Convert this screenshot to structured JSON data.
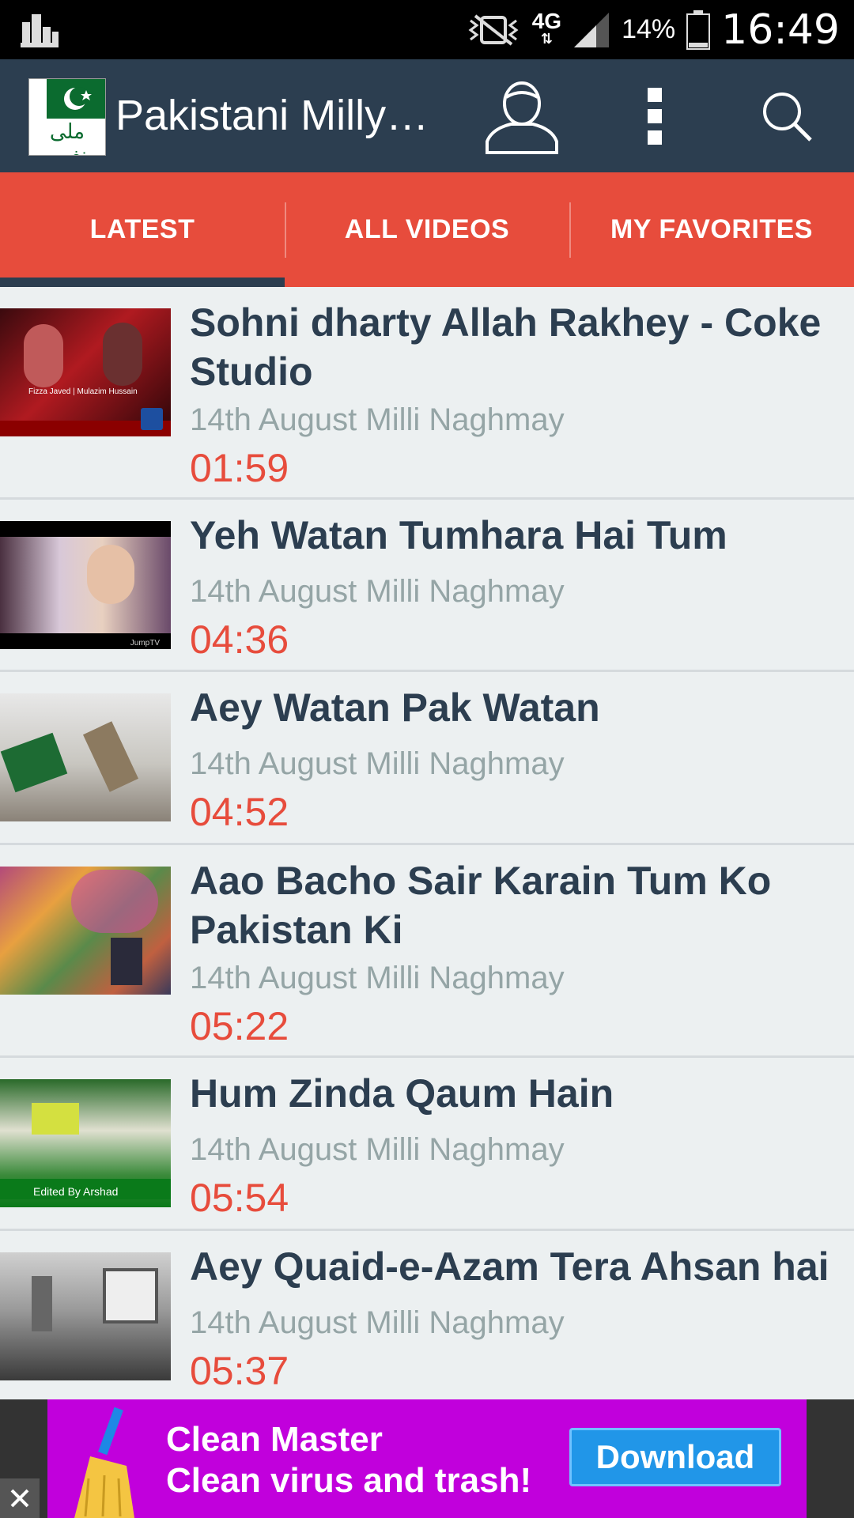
{
  "status_bar": {
    "network": "4G",
    "battery": "14%",
    "time": "16:49"
  },
  "app_bar": {
    "title": "Pakistani Milly…",
    "logo_text": "ملی نغمے"
  },
  "tabs": [
    {
      "label": "LATEST",
      "active": true
    },
    {
      "label": "ALL VIDEOS",
      "active": false
    },
    {
      "label": "MY FAVORITES",
      "active": false
    }
  ],
  "videos": [
    {
      "title": "Sohni dharty Allah Rakhey - Coke Studio",
      "category": "14th August Milli Naghmay",
      "duration": "01:59"
    },
    {
      "title": "Yeh Watan Tumhara Hai Tum",
      "category": "14th August Milli Naghmay",
      "duration": "04:36"
    },
    {
      "title": "Aey Watan Pak Watan",
      "category": "14th August Milli Naghmay",
      "duration": "04:52"
    },
    {
      "title": "Aao Bacho Sair Karain Tum Ko Pakistan Ki",
      "category": "14th August Milli Naghmay",
      "duration": "05:22"
    },
    {
      "title": "Hum Zinda Qaum Hain",
      "category": "14th August Milli Naghmay",
      "duration": "05:54"
    },
    {
      "title": "Aey Quaid-e-Azam Tera Ahsan hai",
      "category": "14th August Milli Naghmay",
      "duration": "05:37"
    }
  ],
  "thumb_captions": {
    "t1": "Fizza Javed | Mulazim Hussain",
    "t2": "JumpTV",
    "t5": "Edited By Arshad"
  },
  "ad": {
    "title": "Clean Master",
    "subtitle": "Clean virus and trash!",
    "button": "Download"
  },
  "colors": {
    "app_bar": "#2c3e50",
    "tabs": "#e74c3c",
    "duration": "#e74c3c",
    "title": "#2c3e50",
    "category": "#95a5a6"
  }
}
